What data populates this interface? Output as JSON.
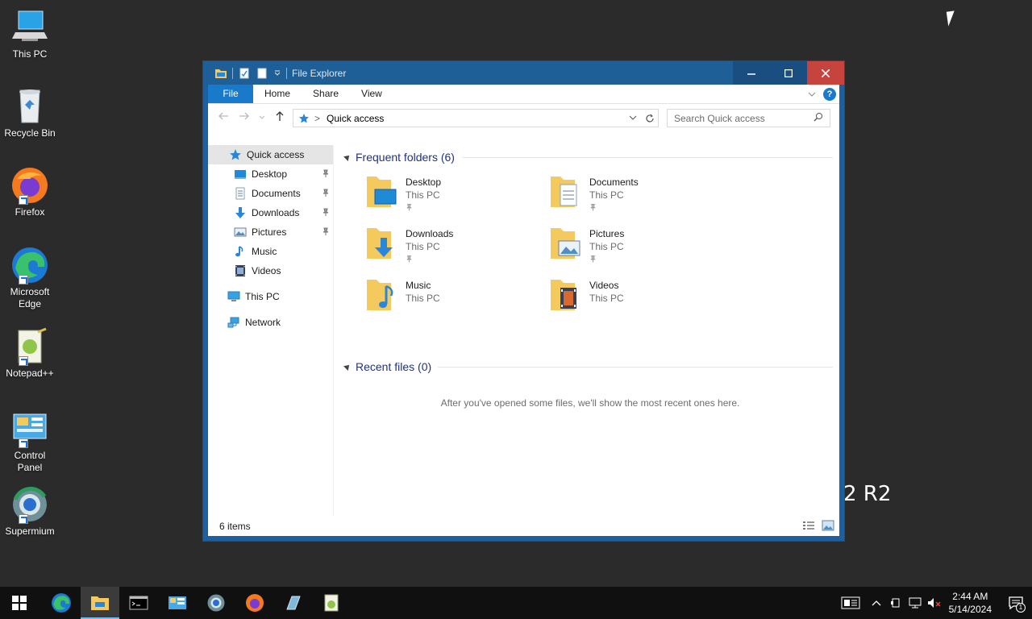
{
  "desktop": {
    "icons": [
      {
        "label": "This PC"
      },
      {
        "label": "Recycle Bin"
      },
      {
        "label": "Firefox"
      },
      {
        "label": "Microsoft Edge"
      },
      {
        "label": "Notepad++"
      },
      {
        "label": "Control Panel"
      },
      {
        "label": "Supermium"
      }
    ],
    "watermark_text": "2 R2"
  },
  "window": {
    "title": "File Explorer",
    "ribbon_tabs": [
      {
        "label": "File"
      },
      {
        "label": "Home"
      },
      {
        "label": "Share"
      },
      {
        "label": "View"
      }
    ],
    "address": {
      "crumb": "Quick access"
    },
    "search": {
      "placeholder": "Search Quick access"
    },
    "nav_pane": [
      {
        "label": "Quick access"
      },
      {
        "label": "Desktop"
      },
      {
        "label": "Documents"
      },
      {
        "label": "Downloads"
      },
      {
        "label": "Pictures"
      },
      {
        "label": "Music"
      },
      {
        "label": "Videos"
      },
      {
        "label": "This PC"
      },
      {
        "label": "Network"
      }
    ],
    "frequent": {
      "header": "Frequent folders (6)",
      "folders": [
        {
          "name": "Desktop",
          "location": "This PC"
        },
        {
          "name": "Documents",
          "location": "This PC"
        },
        {
          "name": "Downloads",
          "location": "This PC"
        },
        {
          "name": "Pictures",
          "location": "This PC"
        },
        {
          "name": "Music",
          "location": "This PC"
        },
        {
          "name": "Videos",
          "location": "This PC"
        }
      ]
    },
    "recent": {
      "header": "Recent files (0)",
      "empty_message": "After you've opened some files, we'll show the most recent ones here."
    },
    "status": {
      "item_count": "6 items"
    }
  },
  "taskbar": {
    "time": "2:44 AM",
    "date": "5/14/2024",
    "notification_count": "1"
  },
  "colors": {
    "accent": "#1979ca",
    "titlebar": "#1f5f98",
    "close": "#c7443e",
    "folder": "#f4c95d"
  }
}
